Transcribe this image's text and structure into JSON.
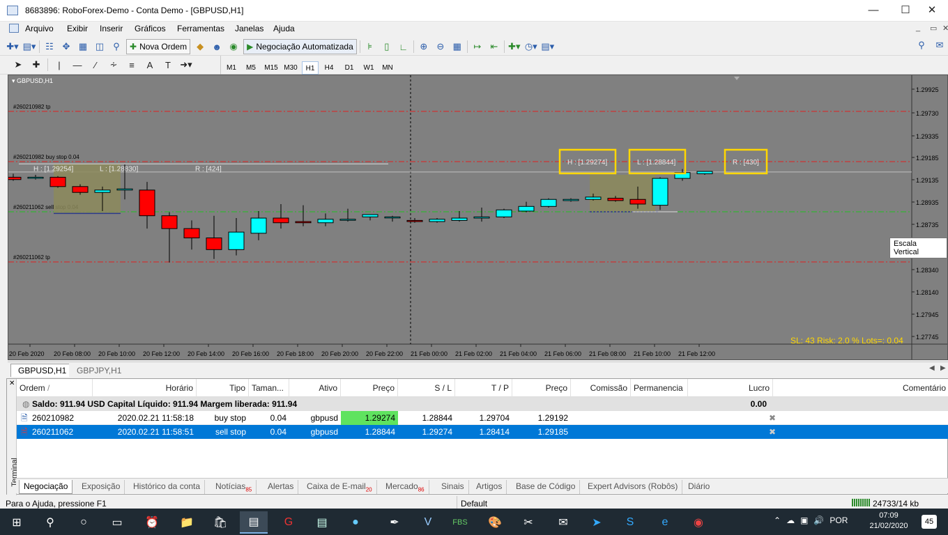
{
  "window": {
    "title": "8683896: RoboForex-Demo - Conta Demo - [GBPUSD,H1]"
  },
  "menu": [
    "Arquivo",
    "Exibir",
    "Inserir",
    "Gráficos",
    "Ferramentas",
    "Janelas",
    "Ajuda"
  ],
  "toolbar": {
    "new_order": "Nova Ordem",
    "auto_trading": "Negociação Automatizada"
  },
  "timeframes": [
    "M1",
    "M5",
    "M15",
    "M30",
    "H1",
    "H4",
    "D1",
    "W1",
    "MN"
  ],
  "active_timeframe": "H1",
  "chart": {
    "symbol_label": "GBPUSD,H1",
    "tooltip": "Escala Vertical",
    "risk_text": "SL: 43  Risk: 2.0 %  Lots=: 0.04",
    "price_ticks": [
      "1.29925",
      "1.29730",
      "1.29335",
      "1.29185",
      "1.29135",
      "1.28935",
      "1.28735",
      "1.28540",
      "1.28340",
      "1.28140",
      "1.27945",
      "1.27745"
    ],
    "time_ticks": [
      "20 Feb 2020",
      "20 Feb 08:00",
      "20 Feb 10:00",
      "20 Feb 12:00",
      "20 Feb 14:00",
      "20 Feb 16:00",
      "20 Feb 18:00",
      "20 Feb 20:00",
      "20 Feb 22:00",
      "21 Feb 00:00",
      "21 Feb 02:00",
      "21 Feb 04:00",
      "21 Feb 06:00",
      "21 Feb 08:00",
      "21 Feb 10:00",
      "21 Feb 12:00"
    ],
    "lines": [
      {
        "label": "#260210982 tp",
        "price": 1.29704,
        "color": "#e02020"
      },
      {
        "label": "#260210982 buy stop 0.04",
        "price": 1.29274,
        "color": "#e02020"
      },
      {
        "label": "#260211062 sell stop 0.04",
        "price": 1.28844,
        "color": "#20c020"
      },
      {
        "label": "#260211062 tp",
        "price": 1.28414,
        "color": "#e02020"
      }
    ],
    "left_box": {
      "h": "H : [1.29254]",
      "l": "L : [1.28830]",
      "r": "R : [424]"
    },
    "right_box": {
      "h": "H : [1.29274]",
      "l": "L : [1.28844]",
      "r": "R : [430]"
    },
    "candles": [
      {
        "o": 1.2914,
        "h": 1.2917,
        "l": 1.2911,
        "c": 1.2912
      },
      {
        "o": 1.2914,
        "h": 1.2916,
        "l": 1.2912,
        "c": 1.2914
      },
      {
        "o": 1.2914,
        "h": 1.2915,
        "l": 1.2905,
        "c": 1.2906
      },
      {
        "o": 1.2906,
        "h": 1.2908,
        "l": 1.2899,
        "c": 1.2901
      },
      {
        "o": 1.2901,
        "h": 1.2906,
        "l": 1.2885,
        "c": 1.2903
      },
      {
        "o": 1.2903,
        "h": 1.2925,
        "l": 1.2895,
        "c": 1.2904
      },
      {
        "o": 1.2903,
        "h": 1.291,
        "l": 1.287,
        "c": 1.2881
      },
      {
        "o": 1.2881,
        "h": 1.2884,
        "l": 1.2841,
        "c": 1.287
      },
      {
        "o": 1.287,
        "h": 1.2877,
        "l": 1.2852,
        "c": 1.2862
      },
      {
        "o": 1.2862,
        "h": 1.2881,
        "l": 1.2844,
        "c": 1.2852
      },
      {
        "o": 1.2852,
        "h": 1.2879,
        "l": 1.2847,
        "c": 1.2867
      },
      {
        "o": 1.2866,
        "h": 1.2885,
        "l": 1.286,
        "c": 1.2879
      },
      {
        "o": 1.2879,
        "h": 1.2891,
        "l": 1.287,
        "c": 1.2875
      },
      {
        "o": 1.2876,
        "h": 1.289,
        "l": 1.2872,
        "c": 1.2875
      },
      {
        "o": 1.2875,
        "h": 1.2883,
        "l": 1.2872,
        "c": 1.2878
      },
      {
        "o": 1.2878,
        "h": 1.2887,
        "l": 1.2876,
        "c": 1.2878
      },
      {
        "o": 1.288,
        "h": 1.2882,
        "l": 1.2877,
        "c": 1.2882
      },
      {
        "o": 1.288,
        "h": 1.2881,
        "l": 1.2876,
        "c": 1.288
      },
      {
        "o": 1.2877,
        "h": 1.2879,
        "l": 1.2875,
        "c": 1.2876
      },
      {
        "o": 1.2876,
        "h": 1.2879,
        "l": 1.2875,
        "c": 1.2878
      },
      {
        "o": 1.2877,
        "h": 1.2885,
        "l": 1.2876,
        "c": 1.2879
      },
      {
        "o": 1.2879,
        "h": 1.2888,
        "l": 1.2876,
        "c": 1.288
      },
      {
        "o": 1.288,
        "h": 1.2887,
        "l": 1.2879,
        "c": 1.2886
      },
      {
        "o": 1.2885,
        "h": 1.2893,
        "l": 1.2884,
        "c": 1.2889
      },
      {
        "o": 1.2889,
        "h": 1.2896,
        "l": 1.2888,
        "c": 1.2895
      },
      {
        "o": 1.2894,
        "h": 1.2896,
        "l": 1.2893,
        "c": 1.2895
      },
      {
        "o": 1.2895,
        "h": 1.29,
        "l": 1.2894,
        "c": 1.2897
      },
      {
        "o": 1.2896,
        "h": 1.2898,
        "l": 1.2893,
        "c": 1.2894
      },
      {
        "o": 1.2895,
        "h": 1.2906,
        "l": 1.2887,
        "c": 1.2891
      },
      {
        "o": 1.289,
        "h": 1.2914,
        "l": 1.2886,
        "c": 1.2913
      },
      {
        "o": 1.2913,
        "h": 1.2921,
        "l": 1.2911,
        "c": 1.2918
      },
      {
        "o": 1.2917,
        "h": 1.2919,
        "l": 1.2916,
        "c": 1.2919
      }
    ]
  },
  "chart_tabs": [
    "GBPUSD,H1",
    "GBPJPY,H1"
  ],
  "terminal": {
    "side_label": "Terminal",
    "columns": [
      "Ordem",
      "Horário",
      "Tipo",
      "Taman...",
      "Ativo",
      "Preço",
      "S / L",
      "T / P",
      "Preço",
      "Comissão",
      "Permanencia",
      "Lucro",
      "Comentário"
    ],
    "balance": "Saldo: 911.94 USD  Capital Líquido: 911.94  Margem liberada: 911.94",
    "balance_profit": "0.00",
    "orders": [
      {
        "order": "260210982",
        "time": "2020.02.21 11:58:18",
        "type": "buy stop",
        "size": "0.04",
        "symbol": "gbpusd",
        "price": "1.29274",
        "sl": "1.28844",
        "tp": "1.29704",
        "cur": "1.29192"
      },
      {
        "order": "260211062",
        "time": "2020.02.21 11:58:51",
        "type": "sell stop",
        "size": "0.04",
        "symbol": "gbpusd",
        "price": "1.28844",
        "sl": "1.29274",
        "tp": "1.28414",
        "cur": "1.29185"
      }
    ],
    "tabs": [
      {
        "label": "Negociação",
        "badge": ""
      },
      {
        "label": "Exposição",
        "badge": ""
      },
      {
        "label": "Histórico da conta",
        "badge": ""
      },
      {
        "label": "Notícias",
        "badge": "85"
      },
      {
        "label": "Alertas",
        "badge": ""
      },
      {
        "label": "Caixa de E-mail",
        "badge": "20"
      },
      {
        "label": "Mercado",
        "badge": "86"
      },
      {
        "label": "Sinais",
        "badge": ""
      },
      {
        "label": "Artigos",
        "badge": ""
      },
      {
        "label": "Base de Código",
        "badge": ""
      },
      {
        "label": "Expert Advisors (Robôs)",
        "badge": ""
      },
      {
        "label": "Diário",
        "badge": ""
      }
    ]
  },
  "status": {
    "help": "Para o Ajuda, pressione F1",
    "profile": "Default",
    "traffic": "24733/14 kb"
  },
  "taskbar": {
    "lang": "POR",
    "time": "07:09",
    "date": "21/02/2020",
    "notif": "45"
  }
}
